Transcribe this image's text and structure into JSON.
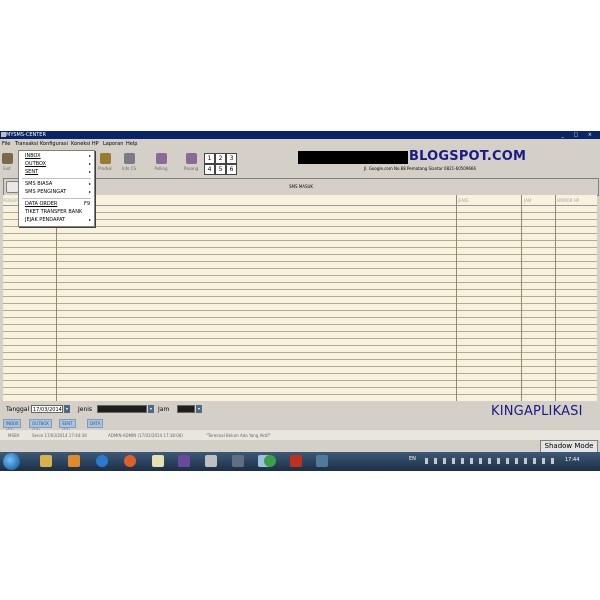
{
  "window": {
    "title": "MYSMS-CENTER",
    "buttons": "_ □ ×"
  },
  "menubar": [
    "File",
    "Transaksi",
    "Konfigurasi",
    "Koneksi HP",
    "Laporan",
    "Help"
  ],
  "toolbar": {
    "buttons": [
      {
        "label": "Exit",
        "icon": "door-icon",
        "color": "#7a6a4a"
      },
      {
        "label": "Produk",
        "icon": "gears-icon",
        "color": "#9a7a30"
      },
      {
        "label": "Info CS",
        "icon": "people-icon",
        "color": "#7a7a8a"
      },
      {
        "label": "Polling",
        "icon": "pencil-icon",
        "color": "#8a6a9a"
      },
      {
        "label": "Pasang",
        "icon": "thumbtack-icon",
        "color": "#8a6a9a"
      }
    ],
    "numbers": [
      "1",
      "2",
      "3",
      "4",
      "5",
      "6"
    ]
  },
  "brand": {
    "text": "BLOGSPOT.COM",
    "address": "Jl. Google.com No.88 Pematang Siantar 0821-60509666",
    "bottom": "KINGAPLIKASI"
  },
  "panel": {
    "title": "SMS MASUK"
  },
  "grid": {
    "columns": [
      "PENGIRIM",
      "JENIS",
      "JAM",
      "NOMOR HP"
    ]
  },
  "filter": {
    "tanggal_label": "Tanggal",
    "tanggal_value": "17/03/2014",
    "jenis_label": "Jenis",
    "jam_label": "Jam"
  },
  "tabs": [
    "INBOX (F1)",
    "OUTBOX (F4)",
    "SENT (F3)",
    "DATA - LOG"
  ],
  "status": [
    "MSBX",
    "Senin 17/03/2014 17:44:38",
    "ADMIN-ADMIN (17/03/2014 17:38:08)",
    "\"Terminal Belum Ada Yang Aktif\""
  ],
  "shadow_button": "Shadow Mode",
  "dropdown_menu": {
    "group1": [
      "INBOX",
      "OUTBOX",
      "SENT"
    ],
    "group2": [
      "SMS BIASA",
      "SMS PENGINGAT"
    ],
    "group3": [
      "DATA ORDER",
      "TIKET TRANSFER BANK",
      "JEJAK PENDAPAT"
    ],
    "shortcut": "F9"
  },
  "taskbar": {
    "icons": [
      {
        "name": "explorer-icon",
        "color": "#d9b34a"
      },
      {
        "name": "media-player-icon",
        "color": "#e08a2a"
      },
      {
        "name": "internet-explorer-icon",
        "color": "#2a7ad0"
      },
      {
        "name": "firefox-icon",
        "color": "#e0602a"
      },
      {
        "name": "notepad-icon",
        "color": "#e8e0b0"
      },
      {
        "name": "photo-viewer-icon",
        "color": "#6a4a9a"
      },
      {
        "name": "app-window-icon",
        "color": "#c0c0c0"
      },
      {
        "name": "calculator-icon",
        "color": "#607080"
      },
      {
        "name": "document-icon",
        "color": "#a0c0e0"
      },
      {
        "name": "chrome-icon",
        "color": "#3aa04a"
      },
      {
        "name": "acrobat-icon",
        "color": "#c03020"
      },
      {
        "name": "people-icon",
        "color": "#507a9a"
      }
    ],
    "lang": "EN",
    "clock": "17:44"
  }
}
